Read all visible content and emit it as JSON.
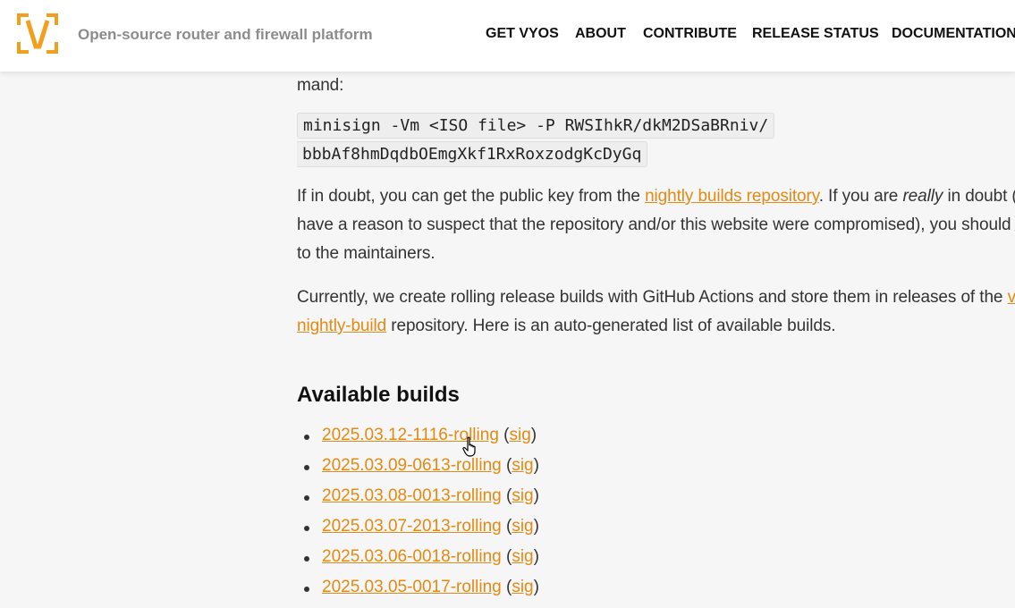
{
  "header": {
    "logo_letter": "V",
    "tagline": "Open-source router and firewall platform",
    "nav": [
      "GET VYOS",
      "ABOUT",
      "CONTRIBUTE",
      "RELEASE STATUS",
      "DOCUMENTATION"
    ]
  },
  "main": {
    "line_mand": "mand:",
    "code_line_1": "minisign -Vm <ISO file> -P RWSIhkR/dkM2DSaBRniv/",
    "code_line_2": "bbbAf8hmDqdbOEmgXkf1RxRoxzodgKcDyGq",
    "p1_part1": "If in doubt, you can get the public key from the ",
    "p1_link": "nightly builds repository",
    "p1_part2": ". If you are ",
    "p1_em": "really",
    "p1_part3": " in doubt (",
    "p1_line2": "have a reason to suspect that the repository and/or this website were compromised), you should",
    "p1_line3": "to the maintainers.",
    "p2_part1": "Currently, we create rolling release builds with GitHub Actions and store them in releases of the ",
    "p2_link_start": "v",
    "p2_link_end": "nightly-build",
    "p2_part2": " repository. Here is an auto-generated list of available builds.",
    "heading": "Available builds",
    "builds": [
      {
        "name": "2025.03.12-1116-rolling",
        "sig": "sig"
      },
      {
        "name": "2025.03.09-0613-rolling",
        "sig": "sig"
      },
      {
        "name": "2025.03.08-0013-rolling",
        "sig": "sig"
      },
      {
        "name": "2025.03.07-2013-rolling",
        "sig": "sig"
      },
      {
        "name": "2025.03.06-0018-rolling",
        "sig": "sig"
      },
      {
        "name": "2025.03.05-0017-rolling",
        "sig": "sig"
      }
    ],
    "paren_open": "(",
    "paren_close": ")"
  },
  "colors": {
    "brand_orange": "#f0a01e",
    "link": "#e38a13",
    "background": "#f6f6f6"
  },
  "icons": [
    "vyos-logo-icon",
    "hand-pointer-cursor-icon"
  ]
}
